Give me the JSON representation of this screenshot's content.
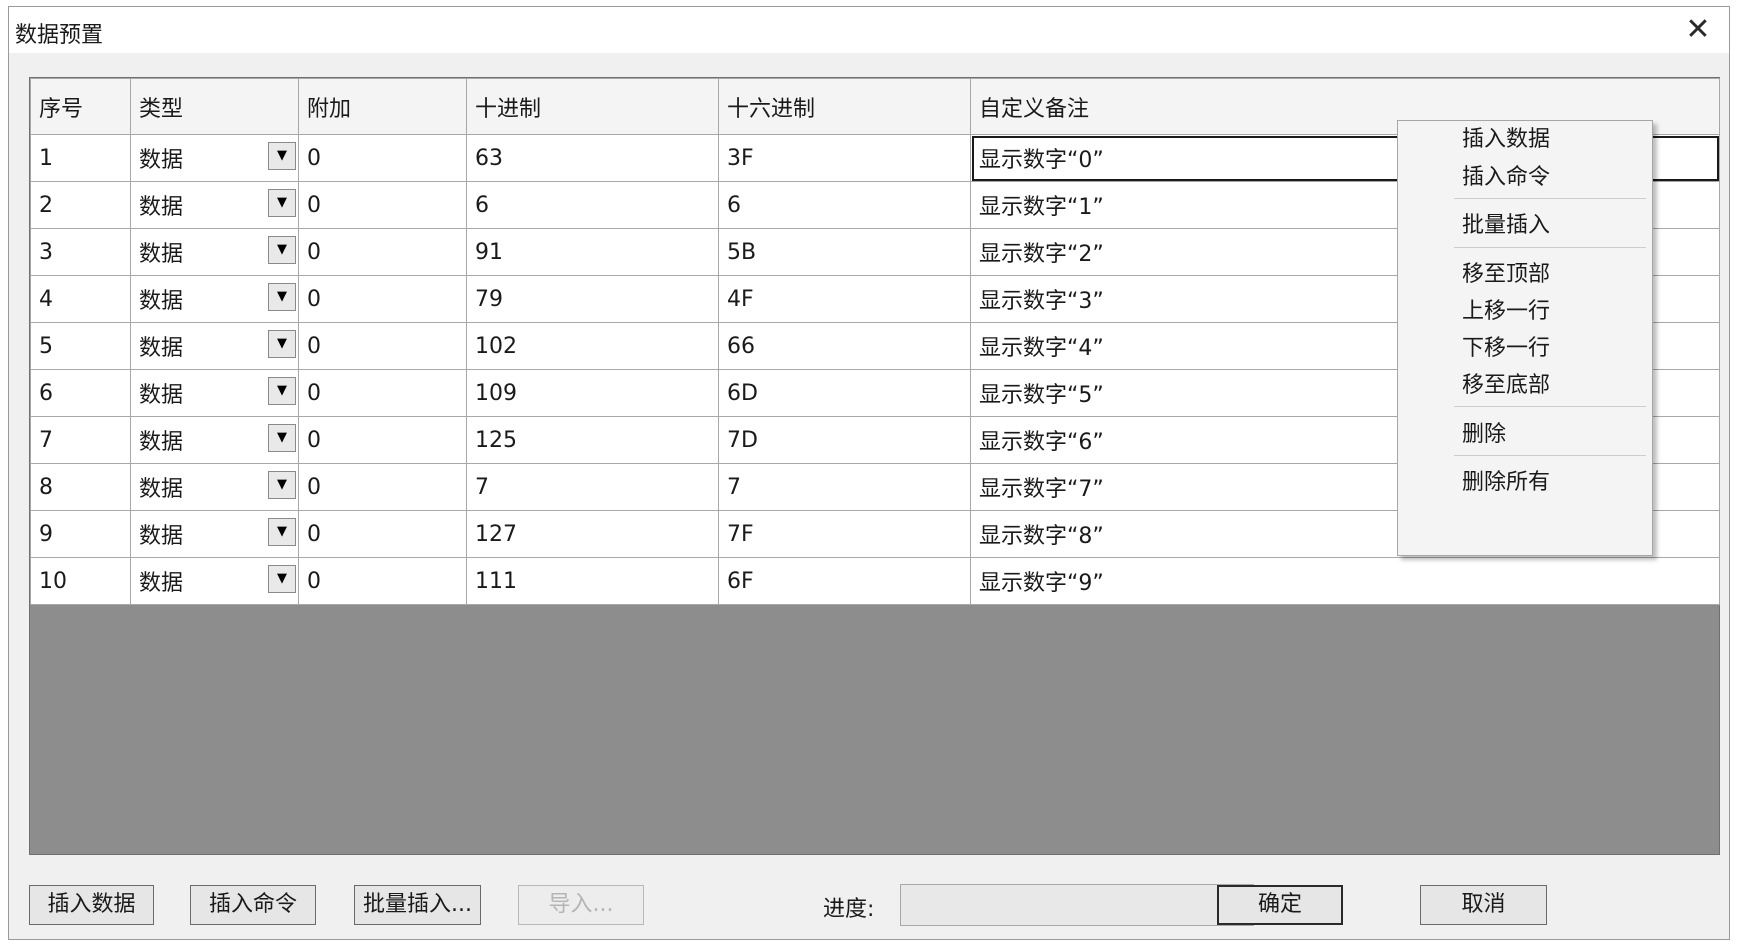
{
  "window": {
    "title": "数据预置",
    "close_glyph": "✕"
  },
  "table": {
    "columns": [
      "序号",
      "类型",
      "附加",
      "十进制",
      "十六进制",
      "自定义备注"
    ],
    "rows": [
      {
        "seq": "1",
        "type": "数据",
        "extra": "0",
        "dec": "63",
        "hex": "3F",
        "note": "显示数字“0”"
      },
      {
        "seq": "2",
        "type": "数据",
        "extra": "0",
        "dec": "6",
        "hex": "6",
        "note": "显示数字“1”"
      },
      {
        "seq": "3",
        "type": "数据",
        "extra": "0",
        "dec": "91",
        "hex": "5B",
        "note": "显示数字“2”"
      },
      {
        "seq": "4",
        "type": "数据",
        "extra": "0",
        "dec": "79",
        "hex": "4F",
        "note": "显示数字“3”"
      },
      {
        "seq": "5",
        "type": "数据",
        "extra": "0",
        "dec": "102",
        "hex": "66",
        "note": "显示数字“4”"
      },
      {
        "seq": "6",
        "type": "数据",
        "extra": "0",
        "dec": "109",
        "hex": "6D",
        "note": "显示数字“5”"
      },
      {
        "seq": "7",
        "type": "数据",
        "extra": "0",
        "dec": "125",
        "hex": "7D",
        "note": "显示数字“6”"
      },
      {
        "seq": "8",
        "type": "数据",
        "extra": "0",
        "dec": "7",
        "hex": "7",
        "note": "显示数字“7”"
      },
      {
        "seq": "9",
        "type": "数据",
        "extra": "0",
        "dec": "127",
        "hex": "7F",
        "note": "显示数字“8”"
      },
      {
        "seq": "10",
        "type": "数据",
        "extra": "0",
        "dec": "111",
        "hex": "6F",
        "note": "显示数字“9”"
      }
    ]
  },
  "context_menu": {
    "items": [
      "插入数据",
      "插入命令",
      "批量插入",
      "移至顶部",
      "上移一行",
      "下移一行",
      "移至底部",
      "删除",
      "删除所有"
    ]
  },
  "footer": {
    "insert_data": "插入数据",
    "insert_command": "插入命令",
    "batch_insert": "批量插入...",
    "import": "导入...",
    "progress_label": "进度:",
    "progress_value": 0,
    "ok": "确定",
    "cancel": "取消"
  },
  "icons": {
    "dropdown": "dropdown-arrow-icon",
    "close": "close-icon"
  },
  "colors": {
    "grid_empty": "#8d8d8d",
    "dialog_bg": "#f0f0f0"
  }
}
